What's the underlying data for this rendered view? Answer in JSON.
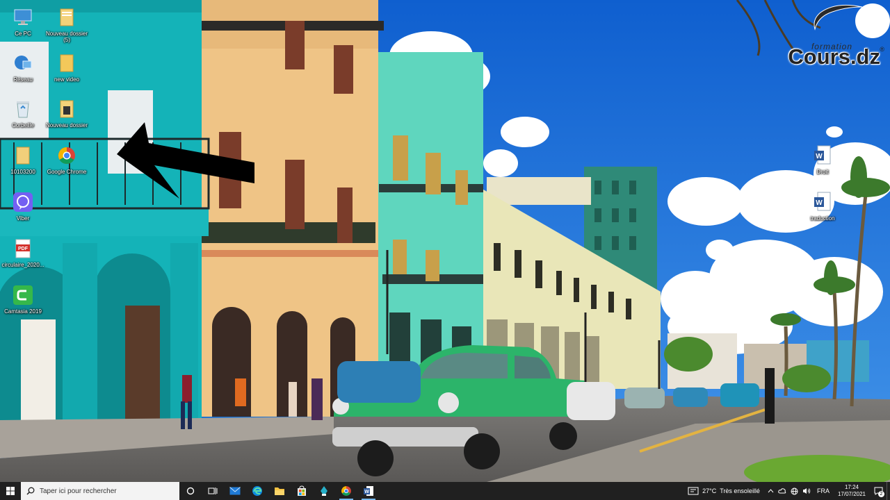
{
  "desktop": {
    "icons": [
      {
        "label": "Ce PC",
        "icon": "computer-icon"
      },
      {
        "label": "Nouveau dossier (5)",
        "icon": "folder-icon"
      },
      {
        "label": "Réseau",
        "icon": "network-icon"
      },
      {
        "label": "new video",
        "icon": "folder-icon"
      },
      {
        "label": "Corbeille",
        "icon": "recycle-bin-icon"
      },
      {
        "label": "Nouveau dossier",
        "icon": "folder-icon"
      },
      {
        "label": "10103200",
        "icon": "folder-icon"
      },
      {
        "label": "Google Chrome",
        "icon": "chrome-icon"
      },
      {
        "label": "Viber",
        "icon": "viber-icon"
      },
      {
        "label": "circulaire_2020...",
        "icon": "pdf-icon"
      },
      {
        "label": "Camtasia 2019",
        "icon": "camtasia-icon"
      },
      {
        "label": "Droit",
        "icon": "word-document-icon"
      },
      {
        "label": "traduction",
        "icon": "word-document-icon"
      }
    ],
    "pdf_badge": "PDF",
    "word_badge": "W"
  },
  "watermark": {
    "small_text": "formation",
    "brand": "Cours.dz",
    "reg": "®"
  },
  "taskbar": {
    "search_placeholder": "Taper ici pour rechercher",
    "apps": [
      {
        "name": "cortana",
        "icon": "cortana-circle-icon"
      },
      {
        "name": "task-view",
        "icon": "task-view-icon"
      },
      {
        "name": "mail",
        "icon": "mail-icon"
      },
      {
        "name": "edge",
        "icon": "edge-icon"
      },
      {
        "name": "file-explorer",
        "icon": "folder-icon"
      },
      {
        "name": "store",
        "icon": "store-icon"
      },
      {
        "name": "app",
        "icon": "app-icon"
      },
      {
        "name": "chrome",
        "icon": "chrome-icon"
      },
      {
        "name": "word",
        "icon": "word-icon"
      }
    ],
    "weather": {
      "temp": "27°C",
      "condition": "Très ensoleillé"
    },
    "language": "FRA",
    "time": "17:24",
    "date": "17/07/2021",
    "notifications": "2"
  },
  "colors": {
    "taskbar": "#202020",
    "sky": "#1a6fd0",
    "accent": "#76b9ed"
  }
}
